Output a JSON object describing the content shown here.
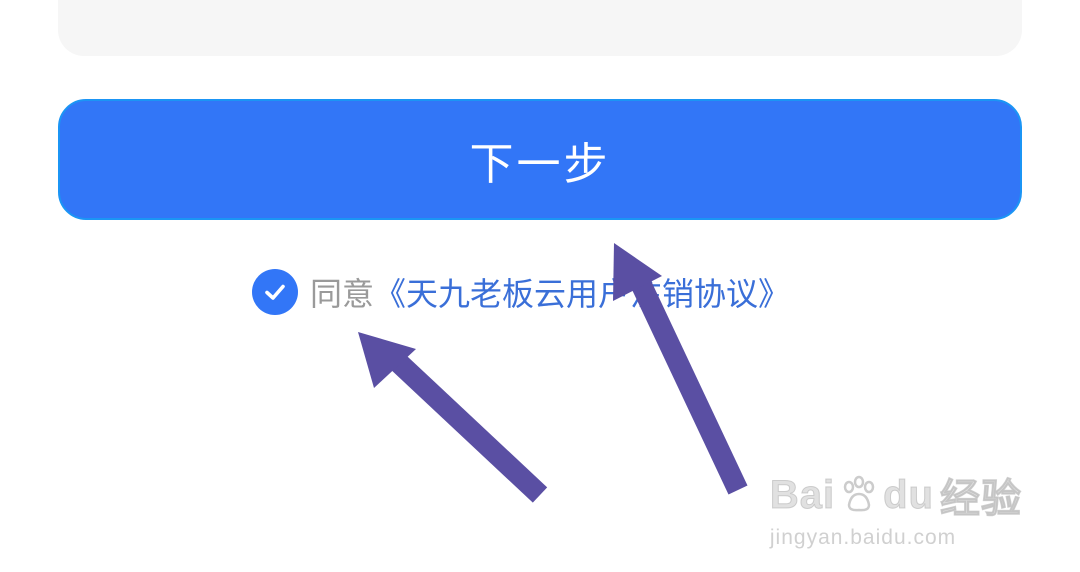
{
  "form": {
    "next_label": "下一步",
    "agree_prefix": "同意",
    "agreement_link": "《天九老板云用户注销协议》",
    "agree_checked": true
  },
  "watermark": {
    "brand_prefix": "Bai",
    "brand_suffix": "du",
    "brand_cn": "经验",
    "url": "jingyan.baidu.com"
  },
  "colors": {
    "primary": "#3276f7",
    "button_border": "#1b95f5",
    "link": "#3a6fd8",
    "muted_text": "#9a9a9a",
    "panel_bg": "#f6f6f6",
    "annotation_arrow": "#5a4fa3"
  },
  "icons": {
    "checkbox": "check-circle-icon",
    "annotation": "arrow-icon",
    "watermark": "paw-icon"
  }
}
